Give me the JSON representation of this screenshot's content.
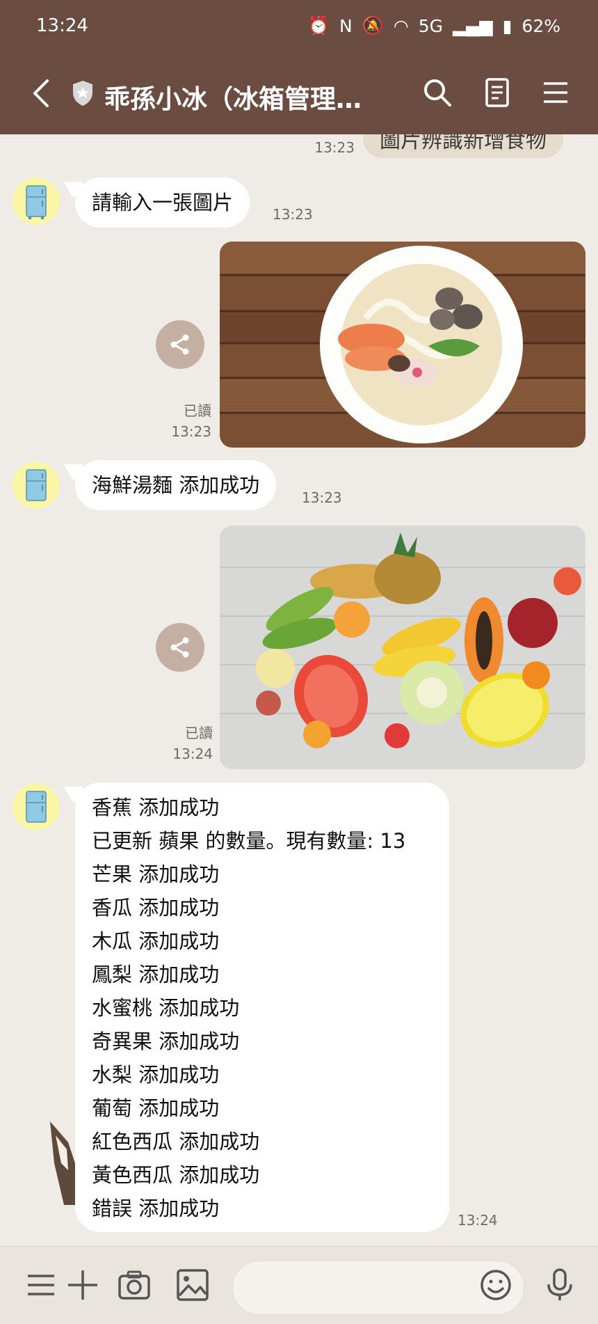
{
  "status_bar": {
    "time": "13:24",
    "network": "5G",
    "battery": "62%"
  },
  "header": {
    "title": "乖孫小冰（冰箱管理系…"
  },
  "messages": {
    "sent_top": {
      "text": "圖片辨識新增食物",
      "time": "13:23"
    },
    "bot1": {
      "text": "請輸入一張圖片",
      "time": "13:23"
    },
    "photo1": {
      "read": "已讀",
      "time": "13:23",
      "subject": "seafood noodle soup bowl"
    },
    "bot2": {
      "text": "海鮮湯麵 添加成功",
      "time": "13:23"
    },
    "photo2": {
      "read": "已讀",
      "time": "13:24",
      "subject": "assorted fruits"
    },
    "bot3": {
      "lines": [
        "香蕉 添加成功",
        "已更新 蘋果 的數量。現有數量: 13",
        "芒果 添加成功",
        "香瓜 添加成功",
        "木瓜 添加成功",
        "鳳梨 添加成功",
        "水蜜桃 添加成功",
        "奇異果 添加成功",
        "水梨 添加成功",
        "葡萄 添加成功",
        "紅色西瓜 添加成功",
        "黃色西瓜 添加成功",
        "錯誤 添加成功"
      ],
      "time": "13:24"
    }
  },
  "input": {
    "placeholder": ""
  },
  "colors": {
    "header_bg": "#6b4c40",
    "chat_bg": "#efebe6",
    "bubble_bg": "#ffffff",
    "sent_bubble_bg": "#e6dccd",
    "avatar_bg": "#f9f7a6"
  }
}
